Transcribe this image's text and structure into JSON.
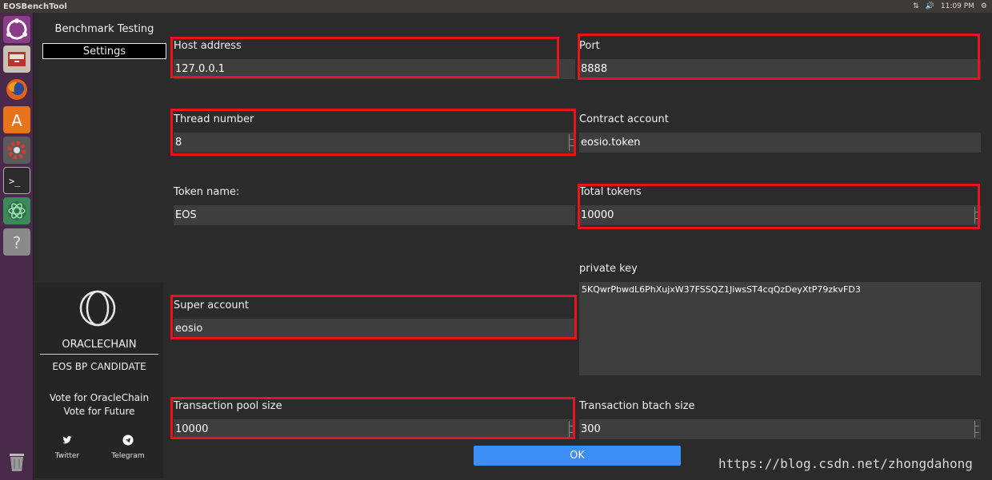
{
  "topbar": {
    "app_title": "EOSBenchTool",
    "clock": "11:09 PM"
  },
  "launcher": {
    "icons": [
      "ubuntu-dash-icon",
      "files-icon",
      "firefox-icon",
      "software-center-icon",
      "settings-icon",
      "terminal-icon",
      "atom-icon",
      "help-icon",
      "trash-icon"
    ]
  },
  "sidebar": {
    "items": [
      {
        "label": "Benchmark Testing"
      },
      {
        "label": "Settings"
      }
    ],
    "brand": {
      "name": "ORACLECHAIN",
      "candidate": "EOS BP CANDIDATE",
      "vote_line1": "Vote for OracleChain",
      "vote_line2": "Vote for Future",
      "twitter_label": "Twitter",
      "telegram_label": "Telegram"
    }
  },
  "form": {
    "host": {
      "label": "Host address",
      "value": "127.0.0.1"
    },
    "port": {
      "label": "Port",
      "value": "8888"
    },
    "thread": {
      "label": "Thread number",
      "value": "8"
    },
    "contract": {
      "label": "Contract account",
      "value": "eosio.token"
    },
    "token_name": {
      "label": "Token name:",
      "value": "EOS"
    },
    "total_tokens": {
      "label": "Total tokens",
      "value": "10000"
    },
    "private_key": {
      "label": "private key",
      "value": "5KQwrPbwdL6PhXujxW37FSSQZ1JiwsST4cqQzDeyXtP79zkvFD3"
    },
    "super_account": {
      "label": "Super account",
      "value": "eosio"
    },
    "pool_size": {
      "label": "Transaction pool size",
      "value": "10000"
    },
    "batch_size": {
      "label": "Transaction btach size",
      "value": "300"
    }
  },
  "ok_label": "OK",
  "watermark": "https://blog.csdn.net/zhongdahong",
  "colors": {
    "accent": "#3b8ef5",
    "highlight": "#e8141c",
    "background": "#2b2b2b",
    "launcher": "#4a2a4a"
  }
}
